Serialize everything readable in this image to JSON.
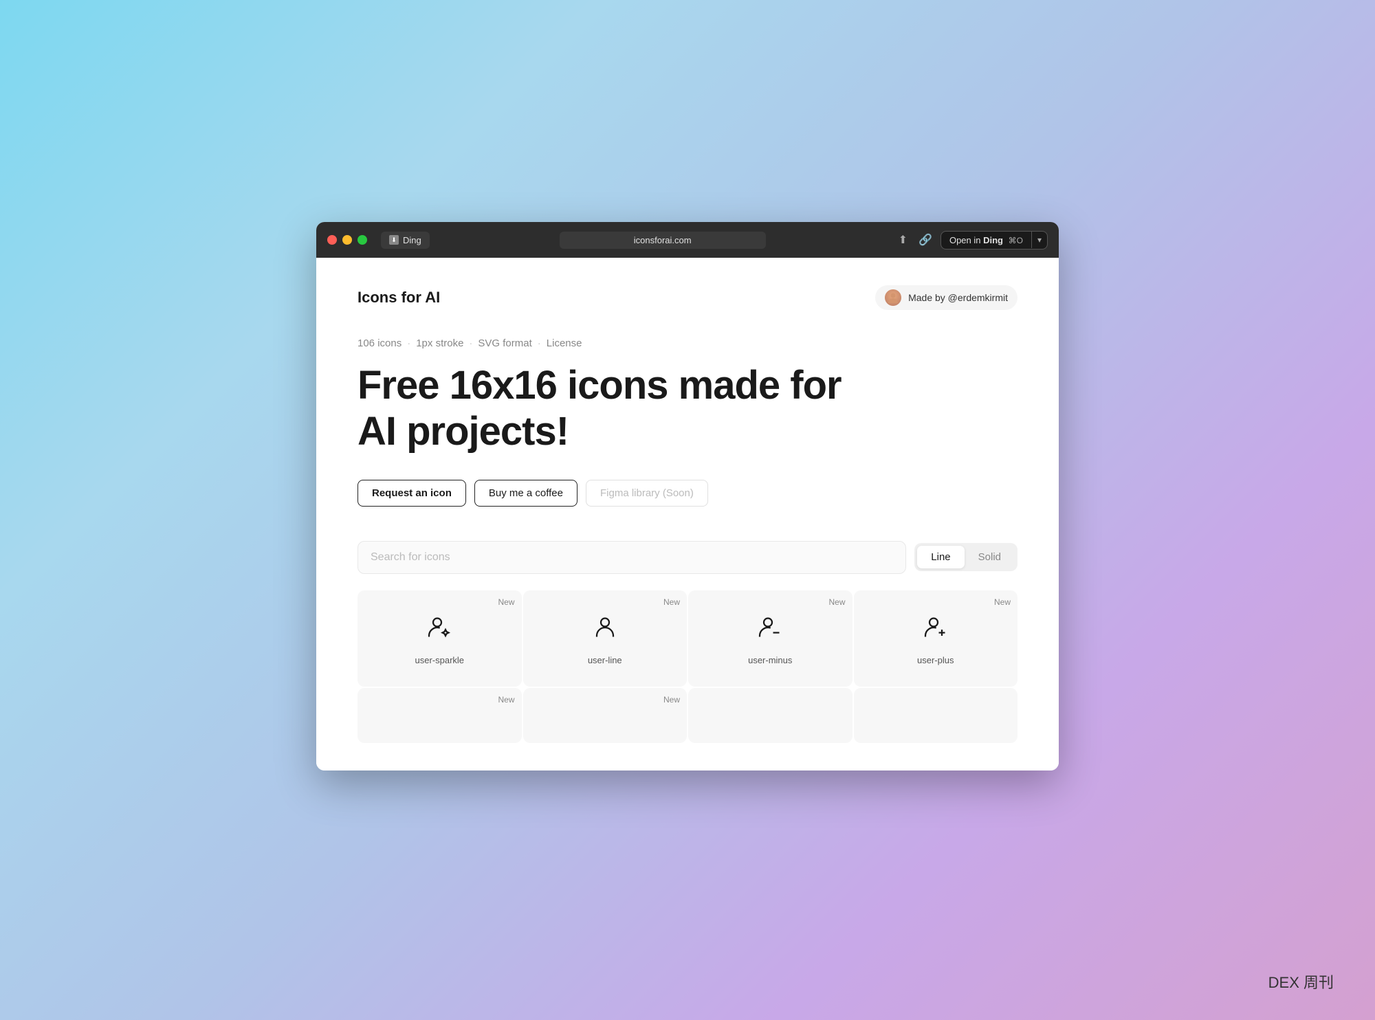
{
  "browser": {
    "traffic_lights": [
      "close",
      "minimize",
      "maximize"
    ],
    "tab_label": "Ding",
    "address": "iconsforai.com",
    "open_in_label": "Open in ",
    "open_in_app": "Ding",
    "open_in_shortcut": "⌘O"
  },
  "header": {
    "site_title": "Icons for AI",
    "made_by_text": "Made by @erdemkirmit"
  },
  "meta": {
    "icon_count": "106 icons",
    "stroke": "1px stroke",
    "format": "SVG format",
    "license": "License"
  },
  "hero": {
    "title_line1": "Free 16x16 icons made for",
    "title_line2": "AI projects!"
  },
  "cta_buttons": {
    "request": "Request an icon",
    "coffee": "Buy me a coffee",
    "figma": "Figma library (Soon)"
  },
  "search": {
    "placeholder": "Search for icons",
    "style_line": "Line",
    "style_solid": "Solid"
  },
  "icons": [
    {
      "name": "user-sparkle",
      "badge": "New",
      "type": "user-sparkle"
    },
    {
      "name": "user-line",
      "badge": "New",
      "type": "user-line"
    },
    {
      "name": "user-minus",
      "badge": "New",
      "type": "user-minus"
    },
    {
      "name": "user-plus",
      "badge": "New",
      "type": "user-plus"
    },
    {
      "name": "",
      "badge": "New",
      "type": "partial"
    },
    {
      "name": "",
      "badge": "New",
      "type": "partial"
    },
    {
      "name": "",
      "badge": "",
      "type": "partial"
    },
    {
      "name": "",
      "badge": "",
      "type": "partial"
    }
  ],
  "footer": {
    "dex_label": "DEX 周刊"
  }
}
